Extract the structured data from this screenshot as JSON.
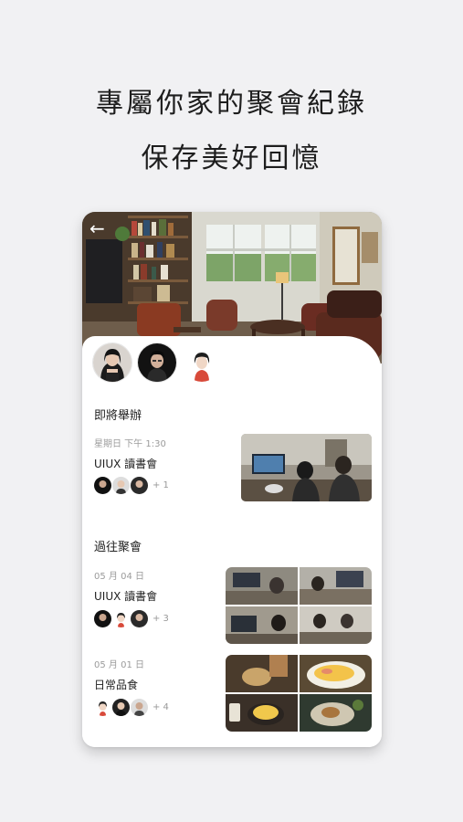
{
  "headline": {
    "line1": "專屬你家的聚會紀錄",
    "line2": "保存美好回憶"
  },
  "nav": {
    "back_icon": "←"
  },
  "upcoming": {
    "title": "即將舉辦",
    "events": [
      {
        "date": "星期日 下午 1:30",
        "name": "UIUX 讀書會",
        "extra": "+ 1"
      }
    ]
  },
  "past": {
    "title": "過往聚會",
    "events": [
      {
        "date": "05 月 04 日",
        "name": "UIUX 讀書會",
        "extra": "+ 3"
      },
      {
        "date": "05 月 01 日",
        "name": "日常品食",
        "extra": "+ 4"
      }
    ]
  },
  "colors": {
    "background": "#f1f1f3",
    "card": "#ffffff",
    "muted_text": "#9b9b9b"
  }
}
